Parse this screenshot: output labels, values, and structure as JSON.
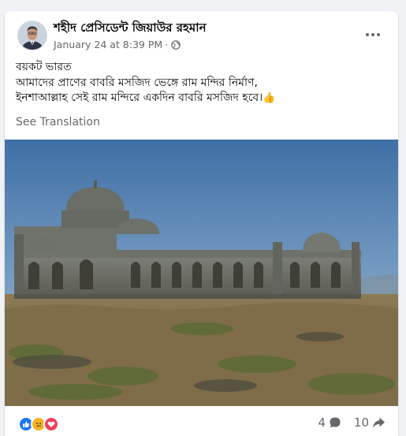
{
  "post": {
    "page_name": "শহীদ প্রেসিডেন্ট জিয়াউর রহমান",
    "timestamp": "January 24 at 8:39 PM",
    "separator": "·",
    "privacy_icon": "globe-icon",
    "more_icon": "more-options-icon",
    "text_lines": [
      "বয়কট ভারত",
      "আমাদের প্রাণের বাবরি মসজিদ ভেঙ্গে রাম মন্দির নির্মাণ,",
      "ইনশাআল্লাহ সেই রাম মন্দিরে একদিন বাবরি মসজিদ হবে।"
    ],
    "text_emoji": "👍",
    "see_translation": "See Translation"
  },
  "footer": {
    "reactions": [
      "like",
      "sad",
      "love"
    ],
    "comment_count": "4",
    "share_count": "10"
  },
  "colors": {
    "background": "#f0f2f5",
    "card": "#ffffff",
    "text": "#050505",
    "secondary_text": "#65676b",
    "like_blue": "#1877f2",
    "love_red": "#f33e58",
    "sad_yellow": "#f7b125"
  }
}
